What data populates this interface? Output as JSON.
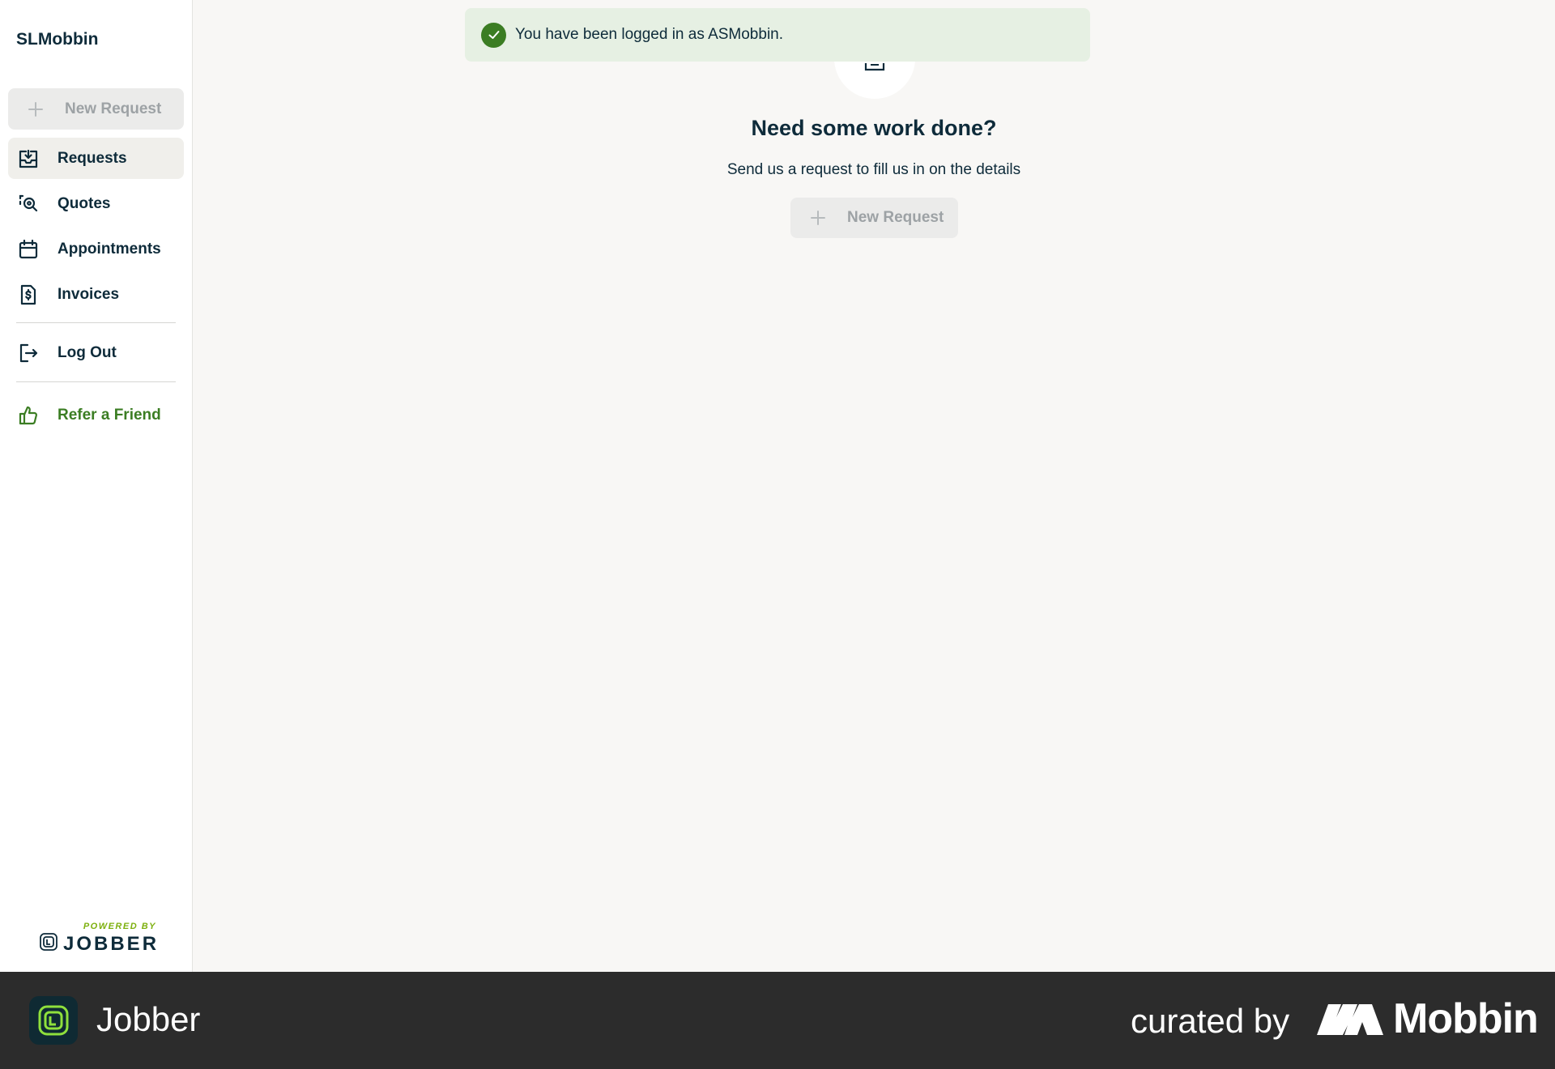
{
  "sidebar": {
    "brand": "SLMobbin",
    "new_request_label": "New Request",
    "items": [
      {
        "label": "Requests",
        "icon": "inbox-download-icon",
        "active": true
      },
      {
        "label": "Quotes",
        "icon": "quote-search-icon",
        "active": false
      },
      {
        "label": "Appointments",
        "icon": "calendar-icon",
        "active": false
      },
      {
        "label": "Invoices",
        "icon": "invoice-dollar-icon",
        "active": false
      }
    ],
    "logout_label": "Log Out",
    "refer_label": "Refer a Friend",
    "powered_by": "POWERED BY",
    "powered_brand": "JOBBER"
  },
  "toast": {
    "message": "You have been logged in as ASMobbin.",
    "icon": "check-circle-icon"
  },
  "empty_state": {
    "title": "Need some work done?",
    "subtitle": "Send us a request to fill us in on the details",
    "button_label": "New Request"
  },
  "footer": {
    "app_name": "Jobber",
    "curated_by": "curated by",
    "curator": "Mobbin"
  },
  "colors": {
    "primary_text": "#0e2b3a",
    "accent_green": "#3b7d23",
    "toast_bg": "#e6f0e3",
    "disabled_bg": "#ebebea",
    "footer_bg": "#2c2c2c"
  }
}
